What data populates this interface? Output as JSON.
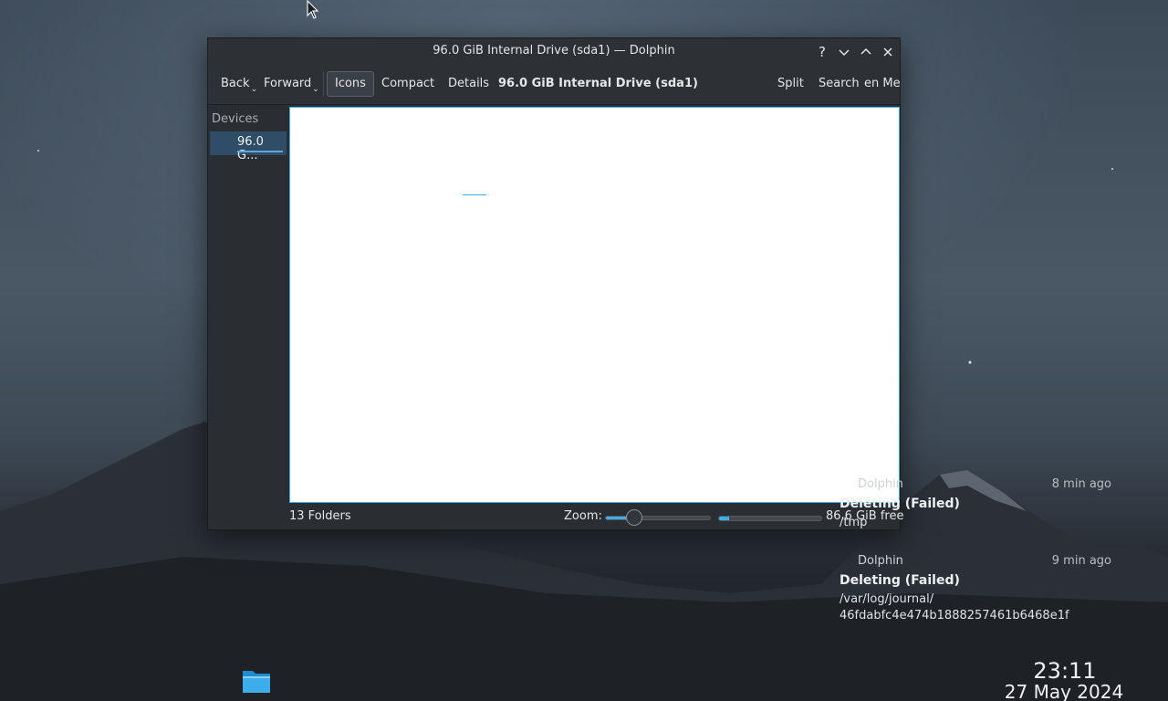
{
  "window": {
    "title": "96.0 GiB Internal Drive (sda1) — Dolphin",
    "help_glyph": "?",
    "minimize_glyph": "⌄",
    "maximize_glyph": "⌃",
    "close_glyph": "✕"
  },
  "toolbar": {
    "back": "Back",
    "forward": "Forward",
    "icons": "Icons",
    "compact": "Compact",
    "details": "Details",
    "location": "96.0 GiB Internal Drive (sda1)",
    "split": "Split",
    "search": "Search",
    "overflow": "en Me"
  },
  "places": {
    "header": "Devices",
    "items": [
      {
        "label": "96.0 G...",
        "usage_fraction": 0.1
      }
    ]
  },
  "statusbar": {
    "folders": "13 Folders",
    "zoom_label": "Zoom:",
    "zoom_fraction": 0.28,
    "used_fraction": 0.1,
    "free_space": "86.6 GiB free"
  },
  "notifications": [
    {
      "app": "Dolphin",
      "time": "8 min ago",
      "title": "Deleting (Failed)",
      "lines": [
        "/tmp"
      ]
    },
    {
      "app": "Dolphin",
      "time": "9 min ago",
      "title": "Deleting (Failed)",
      "lines": [
        "/var/log/journal/",
        "46fdabfc4e474b1888257461b6468e1f"
      ]
    }
  ],
  "clock": {
    "time": "23:11",
    "date": "27 May 2024"
  },
  "icons": {
    "cursor": "mouse-pointer-icon",
    "taskbar": "folder-icon"
  },
  "colors": {
    "accent": "#3daee9",
    "selection": "#2f4d66",
    "window_bg": "#2a2e32"
  }
}
